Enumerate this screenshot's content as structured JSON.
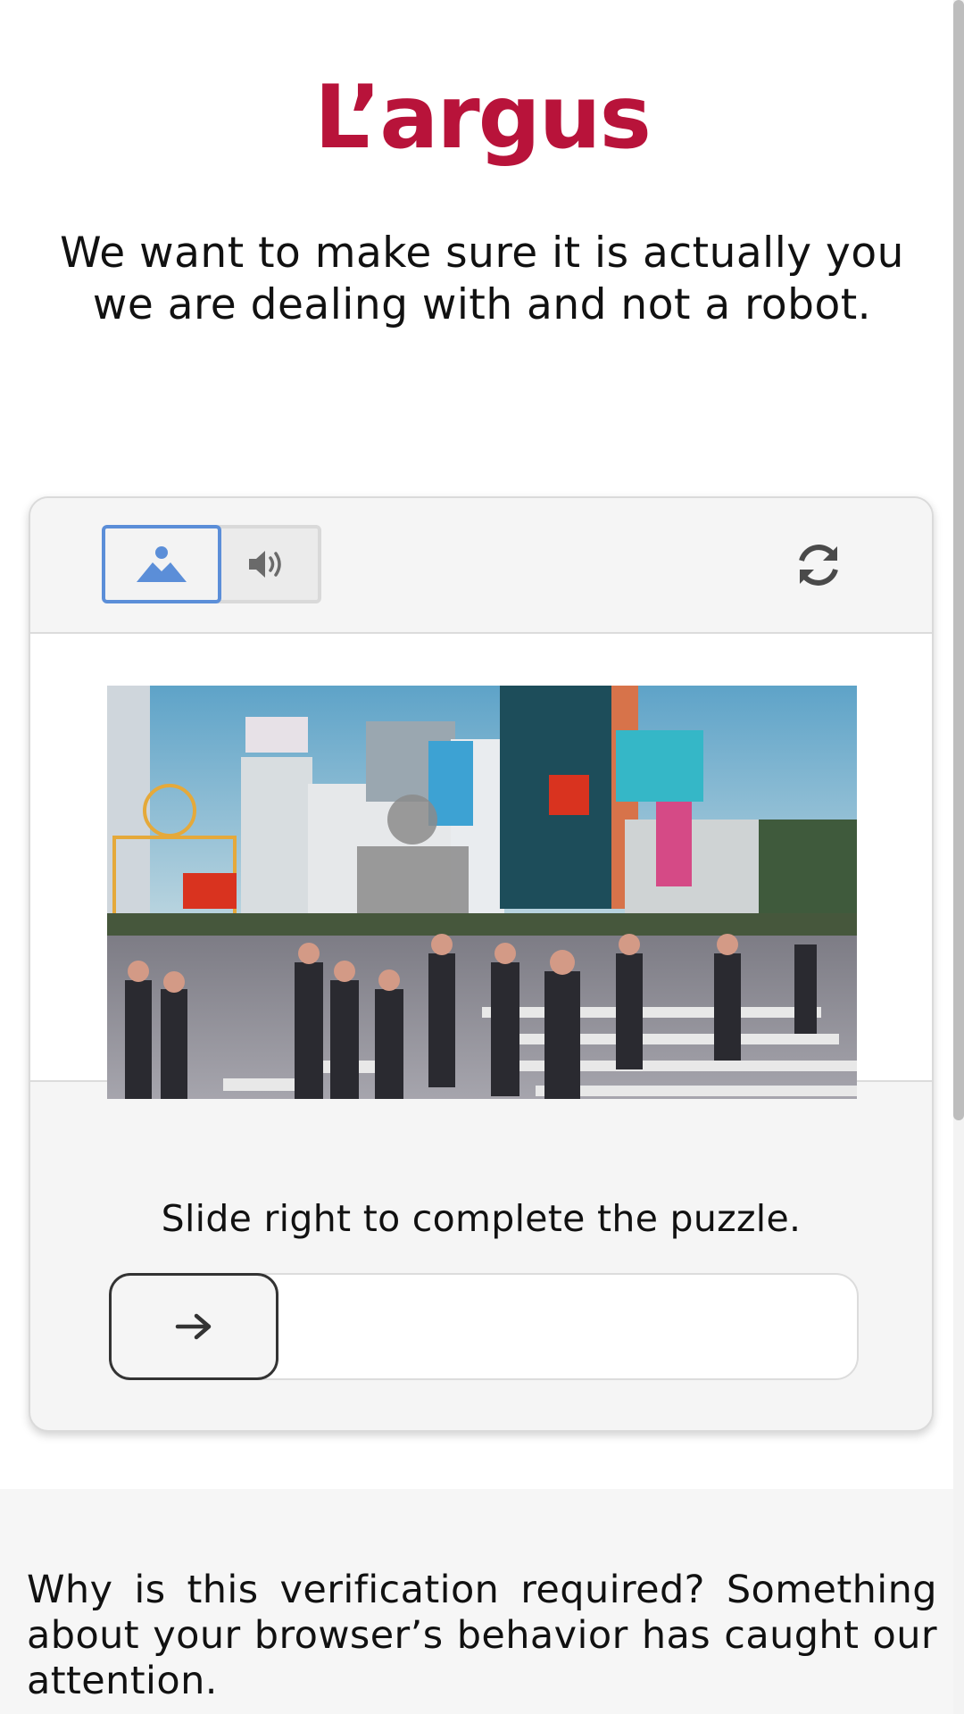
{
  "logo": {
    "text": "L’argus",
    "color": "#b8133a"
  },
  "intro": {
    "text": "We want to make sure it is actually you we are dealing with and not a robot."
  },
  "captcha": {
    "modes": [
      {
        "icon": "image-icon",
        "active": true
      },
      {
        "icon": "speaker-icon",
        "active": false
      }
    ],
    "refresh_icon": "refresh-icon",
    "puzzle_image_description_icon": "puzzle-piece-icon",
    "instruction": "Slide right to complete the puzzle.",
    "slider": {
      "handle_icon": "arrow-right-icon",
      "progress": 0
    },
    "accent_color": "#5b8ed8",
    "piece_outline_color": "#e5a93a"
  },
  "footer": {
    "text": "Why is this verification required? Something about your browser’s behavior has caught our attention."
  }
}
